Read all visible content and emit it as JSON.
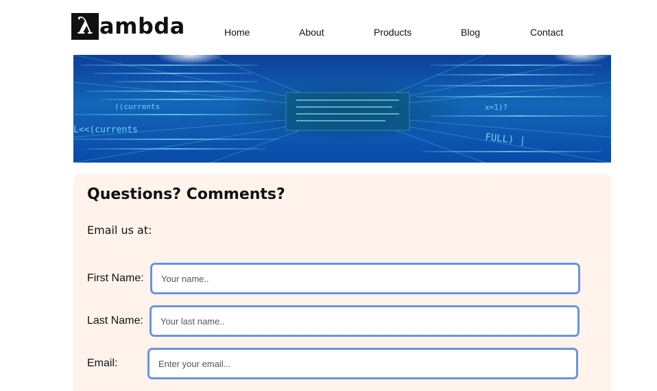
{
  "header": {
    "logo": {
      "symbol": "λ",
      "text": "ambda"
    },
    "nav": [
      "Home",
      "About",
      "Products",
      "Blog",
      "Contact"
    ]
  },
  "banner": {
    "texts": [
      "((currents",
      "L<<(currents",
      "FULL) |",
      "x=1)?"
    ]
  },
  "contact": {
    "title": "Questions? Comments?",
    "email_label": "Email us at:",
    "fields": [
      {
        "label": "First Name:",
        "placeholder": "Your name.."
      },
      {
        "label": "Last Name:",
        "placeholder": "Your last name.."
      },
      {
        "label": "Email:",
        "placeholder": "Enter your email..."
      }
    ]
  },
  "colors": {
    "card_bg": "#fff3ec",
    "field_border": "#6b94dc",
    "banner_blue": "#1266b8",
    "banner_cyan": "#3fd0e8"
  }
}
